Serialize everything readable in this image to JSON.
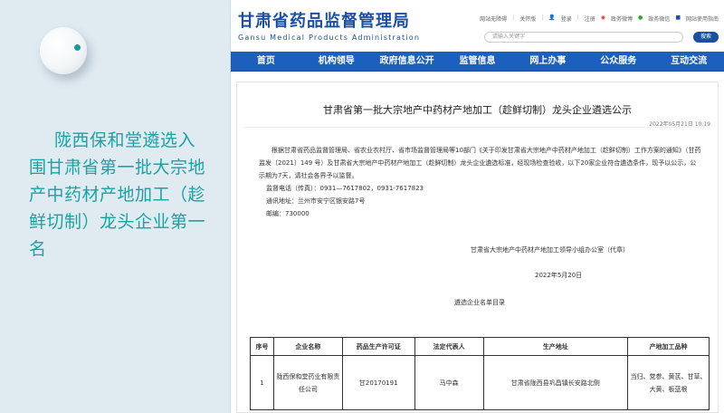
{
  "slide": {
    "headline": "陇西保和堂遴选入围甘肃省第一批大宗地产中药材产地加工（趁鲜切制）龙头企业第一名"
  },
  "site": {
    "name_cn": "甘肃省药品监督管理局",
    "name_en": "Gansu Medical Products Administration",
    "top_links": [
      "网站无障碍",
      "关怀版",
      "登录",
      "注册",
      "政务微博",
      "政务微信",
      "网站使用指南"
    ],
    "search_placeholder": "请输入关键字",
    "search_button": "搜索",
    "nav": [
      "首页",
      "机构领导",
      "政府信息公开",
      "监管信息",
      "网上办事",
      "公众服务",
      "互动交流"
    ]
  },
  "article": {
    "title": "甘肃省第一批大宗地产中药材产地加工（趁鲜切制）龙头企业遴选公示",
    "date": "2022年05月21日 10:19",
    "paragraph": "根据甘肃省药品监督管理局、省农业农村厅、省市场监督管理局等10部门《关于印发甘肃省大宗地产中药材产地加工（趁鲜切制）工作方案的通知》（甘药监发〔2021〕149 号）及甘肃省大宗地产中药材产地加工（趁鲜切制）龙头企业遴选标准，经现场检查验收，以下20家企业符合遴选条件，现予以公示，公示期为7天，请社会各界予以监督。",
    "phone": "监督电话（传真）：0931—7617802，0931-7617823",
    "address": "通讯地址：兰州市安宁区银安路7号",
    "postcode": "邮编：730000",
    "signature_org": "甘肃省大宗地产中药材产地加工领导小组办公室（代章）",
    "signature_date": "2022年5月20日",
    "list_title": "遴选企业名单目录"
  },
  "table": {
    "headers": [
      "序号",
      "企业名称",
      "药品生产许可证",
      "法定代表人",
      "生产地址",
      "产地加工品种"
    ],
    "rows": [
      [
        "1",
        "陇西保和堂药业有限责任公司",
        "甘20170191",
        "马中森",
        "甘肃省陇西县巩昌镇长安路北侧",
        "当归、党参、黄芪、甘草、大黄、板蓝根"
      ]
    ]
  }
}
